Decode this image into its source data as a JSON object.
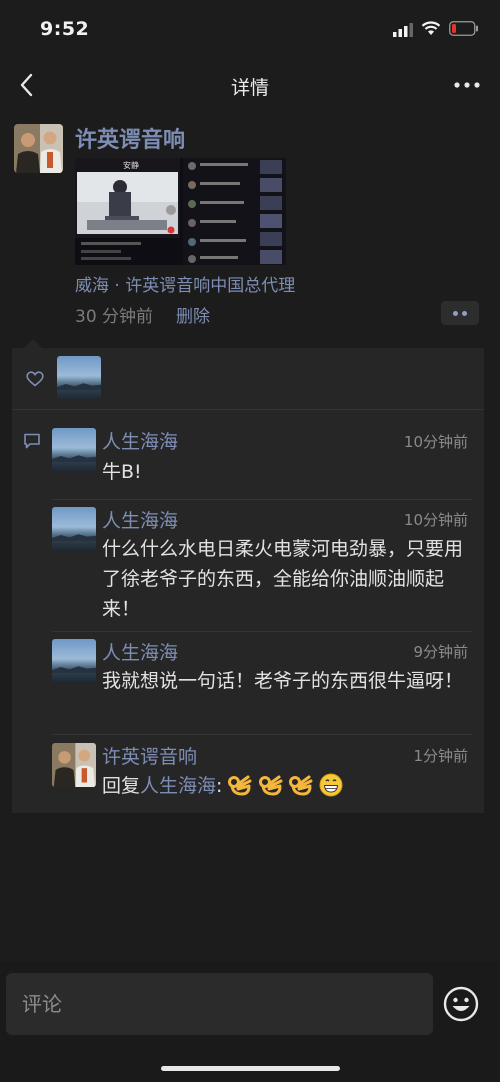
{
  "status_bar": {
    "time": "9:52"
  },
  "nav": {
    "title": "详情"
  },
  "post": {
    "author": "许英谔音响",
    "location": "威海 · 许英谔音响中国总代理",
    "time": "30 分钟前",
    "delete_label": "删除",
    "thumbnail": {
      "title": "安静",
      "feed_items": [
        "会引起的视频",
        "音乐测试二",
        "我们的音响",
        "马上就好了",
        "大家都喜欢",
        "正在播放中"
      ]
    }
  },
  "likes": {
    "icon": "heart-icon"
  },
  "comments": [
    {
      "author": "人生海海",
      "time": "10分钟前",
      "text": "牛B!",
      "avatar": "sea-landscape"
    },
    {
      "author": "人生海海",
      "time": "10分钟前",
      "text": "什么什么水电日柔火电蒙河电劲暴，只要用了徐老爷子的东西，全能给你油顺油顺起来！",
      "avatar": "sea-landscape"
    },
    {
      "author": "人生海海",
      "time": "9分钟前",
      "text": "我就想说一句话！老爷子的东西很牛逼呀！",
      "avatar": "sea-landscape"
    },
    {
      "author": "许英谔音响",
      "time": "1分钟前",
      "reply_prefix": "回复",
      "reply_to": "人生海海",
      "reply_suffix": ":",
      "emojis": "👌👌👌😁",
      "avatar": "two-men-photo"
    }
  ],
  "input": {
    "placeholder": "评论"
  },
  "colors": {
    "link": "#7d8db4",
    "background": "#1c1c1c",
    "panel": "#262626"
  }
}
